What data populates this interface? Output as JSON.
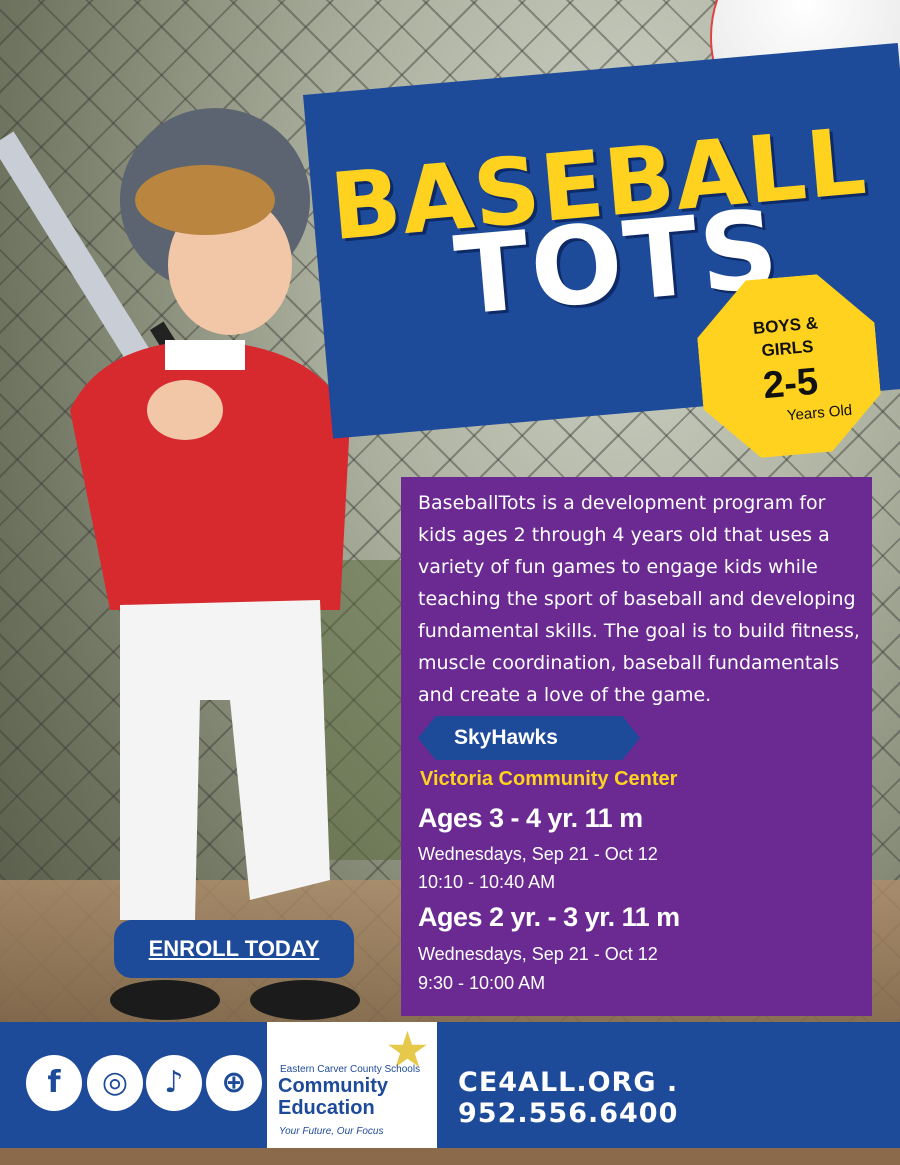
{
  "title": {
    "line1": "BASEBALL",
    "line2": "TOTS"
  },
  "badge": {
    "line1": "BOYS &",
    "line2": "GIRLS",
    "ages": "2-5",
    "suffix": "Years Old"
  },
  "description": "BaseballTots is a development program for kids ages 2 through 4 years old that uses a variety of fun games to engage kids while teaching the sport of baseball and developing fundamental skills. The goal is to build fitness, muscle coordination, baseball fundamentals and create a love of the game.",
  "provider": "SkyHawks",
  "location": "Victoria Community Center",
  "sessions": [
    {
      "ages": "Ages 3 - 4 yr. 11 m",
      "days": "Wednesdays, Sep 21 - Oct 12",
      "time": "10:10 - 10:40 AM"
    },
    {
      "ages": "Ages  2 yr. - 3 yr. 11 m",
      "days": "Wednesdays, Sep 21 - Oct 12",
      "time": "9:30 - 10:00 AM"
    }
  ],
  "cta": "ENROLL TODAY",
  "footer": {
    "social_icons": [
      "facebook-icon",
      "instagram-icon",
      "twitter-icon",
      "globe-icon"
    ],
    "logo_line1": "Eastern Carver County Schools",
    "logo_line2": "Community",
    "logo_line3": "Education",
    "logo_tagline": "Your Future, Our Focus",
    "contact": "CE4ALL.ORG . 952.556.6400"
  },
  "colors": {
    "blue": "#1e4a9a",
    "purple": "#6a2a92",
    "yellow": "#ffd21f"
  }
}
